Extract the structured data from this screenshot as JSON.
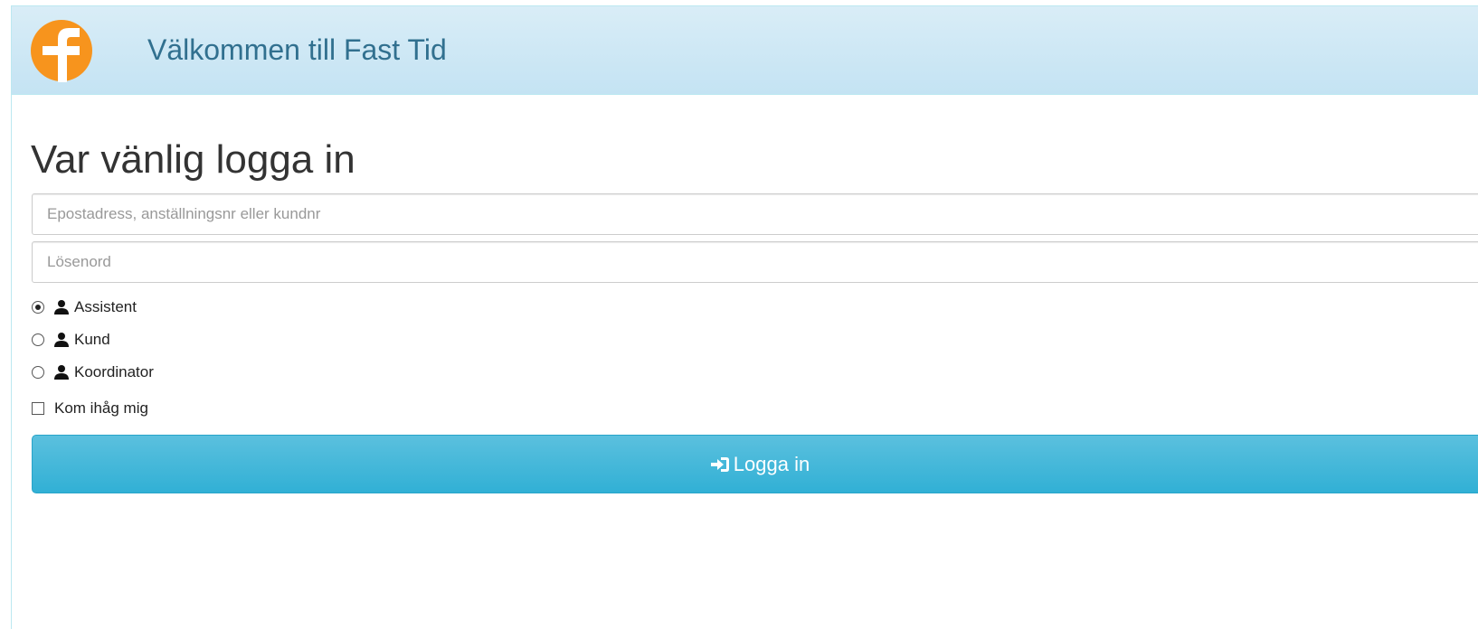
{
  "header": {
    "title": "Välkommen till Fast Tid",
    "logo_icon": "fast-tid-logo",
    "brand_color": "#f7941d"
  },
  "login": {
    "heading": "Var vänlig logga in",
    "username_placeholder": "Epostadress, anställningsnr eller kundnr",
    "username_value": "",
    "password_placeholder": "Lösenord",
    "password_value": "",
    "roles": [
      {
        "label": "Assistent",
        "selected": true,
        "icon": "user-icon"
      },
      {
        "label": "Kund",
        "selected": false,
        "icon": "user-icon"
      },
      {
        "label": "Koordinator",
        "selected": false,
        "icon": "user-icon"
      }
    ],
    "remember_label": "Kom ihåg mig",
    "remember_checked": false,
    "submit_label": "Logga in",
    "submit_icon": "log-in-icon",
    "submit_color": "#31b0d5"
  }
}
